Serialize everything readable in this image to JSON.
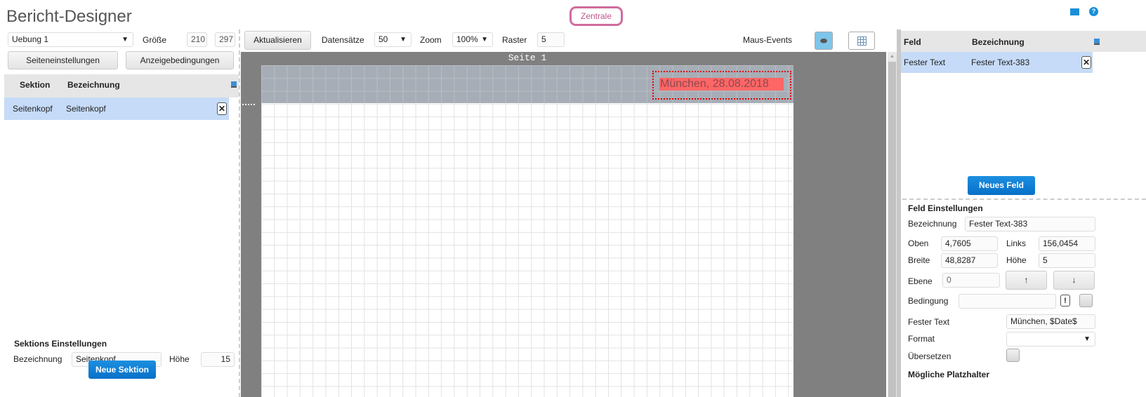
{
  "header": {
    "title": "Bericht-Designer",
    "center_button": "Zentrale",
    "icons": [
      "mail-icon",
      "help-icon"
    ]
  },
  "left": {
    "report_select": "Uebung 1",
    "size_label": "Größe",
    "size_w": "210",
    "size_h": "297",
    "page_settings_button": "Seiteneinstellungen",
    "display_conditions_button": "Anzeigebedingungen",
    "table": {
      "headers": [
        "Sektion",
        "Bezeichnung"
      ],
      "rows": [
        {
          "section": "Seitenkopf",
          "name": "Seitenkopf",
          "delete": "✕"
        }
      ]
    },
    "section_settings": {
      "title": "Sektions Einstellungen",
      "name_label": "Bezeichnung",
      "name_value": "Seitenkopf",
      "height_label": "Höhe",
      "height_value": "15",
      "new_button": "Neue Sektion"
    }
  },
  "toolbar": {
    "refresh_button": "Aktualisieren",
    "records_label": "Datensätze",
    "records_value": "50",
    "zoom_label": "Zoom",
    "zoom_value": "100%",
    "grid_label": "Raster",
    "grid_value": "5",
    "mouse_events_label": "Maus-Events"
  },
  "canvas": {
    "page_label": "Seite 1",
    "field_text": "München, 28.08.2018"
  },
  "right": {
    "table": {
      "headers": [
        "Feld",
        "Bezeichnung"
      ],
      "rows": [
        {
          "field": "Fester Text",
          "name": "Fester Text-383",
          "delete": "✕"
        }
      ]
    },
    "new_field_button": "Neues Feld",
    "settings": {
      "title": "Feld Einstellungen",
      "name_label": "Bezeichnung",
      "name_value": "Fester Text-383",
      "top_label": "Oben",
      "top_value": "4,7605",
      "left_label": "Links",
      "left_value": "156,0454",
      "width_label": "Breite",
      "width_value": "48,8287",
      "height_label": "Höhe",
      "height_value": "5",
      "layer_label": "Ebene",
      "layer_value": "0",
      "up": "↑",
      "down": "↓",
      "condition_label": "Bedingung",
      "condition_value": "",
      "condition_excl": "!",
      "fixed_text_label": "Fester Text",
      "fixed_text_value": "München, $Date$",
      "format_label": "Format",
      "format_value": "",
      "translate_label": "Übersetzen",
      "placeholders_title": "Mögliche Platzhalter"
    }
  }
}
